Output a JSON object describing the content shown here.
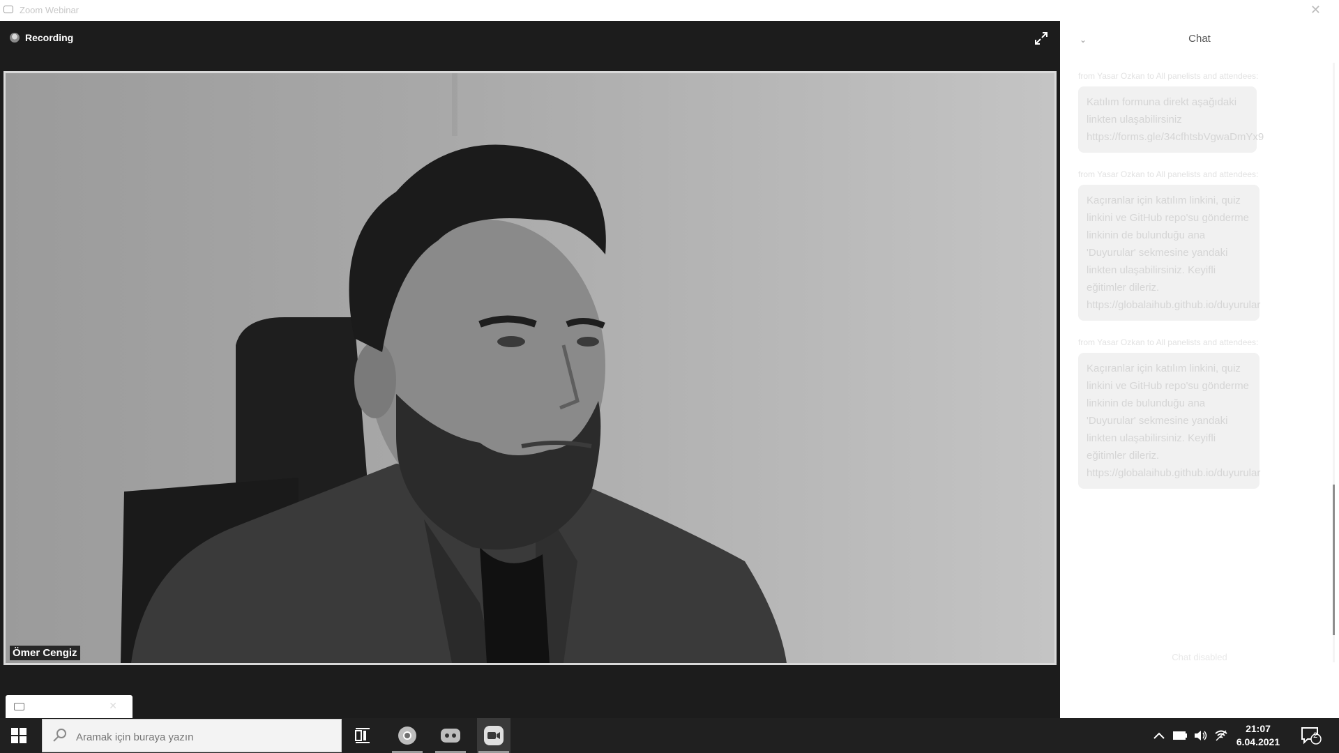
{
  "window": {
    "title": "Zoom Webinar",
    "close_glyph": "✕"
  },
  "stage": {
    "recording_label": "Recording",
    "expand_icon": "expand-icon"
  },
  "video": {
    "participant_name": "Ömer Cengiz"
  },
  "chat": {
    "title": "Chat",
    "messages": [
      {
        "meta": "from Yasar Ozkan to All panelists and attendees:",
        "text": "Katılım formuna direkt aşağıdaki linkten ulaşabilirsiniz https://forms.gle/34cfhtsbVgwaDmYx9"
      },
      {
        "meta": "from Yasar Ozkan to All panelists and attendees:",
        "text": "Kaçıranlar için katılım linkini, quiz linkini ve GitHub repo'su gönderme linkinin de bulunduğu ana 'Duyurular' sekmesine yandaki linkten ulaşabilirsiniz. Keyifli eğitimler dileriz. https://globalaihub.github.io/duyurular"
      },
      {
        "meta": "from Yasar Ozkan to All panelists and attendees:",
        "text": "Kaçıranlar için katılım linkini, quiz linkini ve GitHub repo'su gönderme linkinin de bulunduğu ana 'Duyurular' sekmesine yandaki linkten ulaşabilirsiniz. Keyifli eğitimler dileriz. https://globalaihub.github.io/duyurular"
      }
    ],
    "footer_hint": "Chat disabled"
  },
  "taskbar": {
    "search_placeholder": "Aramak için buraya yazın",
    "clock": {
      "time": "21:07",
      "date": "6.04.2021"
    },
    "notification_count": "2",
    "apps": [
      "task-view",
      "chrome",
      "discord",
      "zoom"
    ]
  },
  "colors": {
    "accent": "#ffffff",
    "video_border": "#d9d9d9",
    "taskbar": "#202020"
  }
}
